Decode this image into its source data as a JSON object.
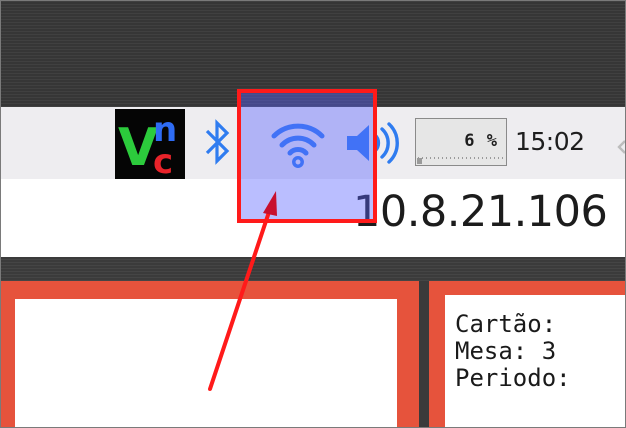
{
  "taskbar": {
    "tray": {
      "vnc": {
        "icon": "vnc-icon",
        "letter_v": "V",
        "letter_n": "n",
        "letter_c": "c",
        "color_v": "#2ccb3c",
        "color_n": "#2e6cf5",
        "color_c": "#e8232a"
      },
      "bluetooth": {
        "icon": "bluetooth-icon",
        "color": "#2f7cf0"
      },
      "wifi": {
        "icon": "wifi-icon",
        "color": "#2f7cf0"
      },
      "volume": {
        "icon": "volume-icon",
        "color": "#2f7cf0"
      },
      "cpu_monitor": {
        "value_text": "6 %",
        "usage_fraction": 0.06
      },
      "clock": {
        "time": "15:02"
      }
    }
  },
  "main": {
    "ip_address": "10.8.21.106",
    "info_panel": {
      "lines": [
        "Cartão:",
        "Mesa: 3",
        "Periodo:"
      ]
    }
  },
  "annotation": {
    "highlight_color": "#ff1a1a",
    "overlay_color": "#5a64ff",
    "arrow_color": "#ff1a1a"
  }
}
